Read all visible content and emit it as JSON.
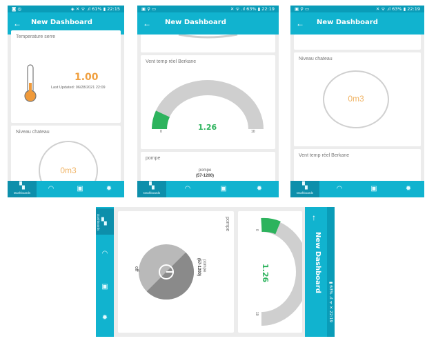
{
  "app": {
    "title": "New Dashboard",
    "back": "←"
  },
  "status_bars": [
    {
      "left": "◙ ◎",
      "right": "◈ ✕ ᯤ .ıl 61% ▮ 22:15"
    },
    {
      "left": "▣ ⚲ ▭",
      "right": "✕ ᯤ .ıl 63% ▮ 22:19"
    },
    {
      "left": "▣ ⚲ ▭",
      "right": "✕ ᯤ .ıl 63% ▮ 22:19"
    },
    {
      "right": "▮ 63% .ıl ᯤ ✕ 22:19"
    }
  ],
  "nav": {
    "dashboards": "Dashboards"
  },
  "screen1": {
    "temp_title": "Temperature serre",
    "temp_value": "1.00",
    "last_updated": "Last Updated: 06/28/2021 22:09",
    "niveau_title": "Niveau chateau",
    "niveau_value": "0m3"
  },
  "screen2": {
    "vent_title": "Vent temp réel Berkane",
    "gauge_value": "1.26",
    "gauge_min": "0",
    "gauge_max": "10",
    "pompe_title": "pompe",
    "pompe_label": "pompe",
    "pompe_range": "(57-1200)"
  },
  "screen3": {
    "niveau_title": "Niveau chateau",
    "niveau_value": "0m3",
    "vent_title": "Vent temp réel Berkane"
  },
  "landscape": {
    "pompe_title": "pompe",
    "pompe_label": "pompe",
    "pompe_range": "(57-1200)",
    "off": "off",
    "gauge_value": "1.26",
    "gauge_min": "0",
    "gauge_max": "10",
    "title": "New Dashboard",
    "up": "↑"
  },
  "colors": {
    "teal": "#11b3cf",
    "green": "#2db35d",
    "orange": "#f0a040",
    "gray": "#cfcfcf"
  }
}
